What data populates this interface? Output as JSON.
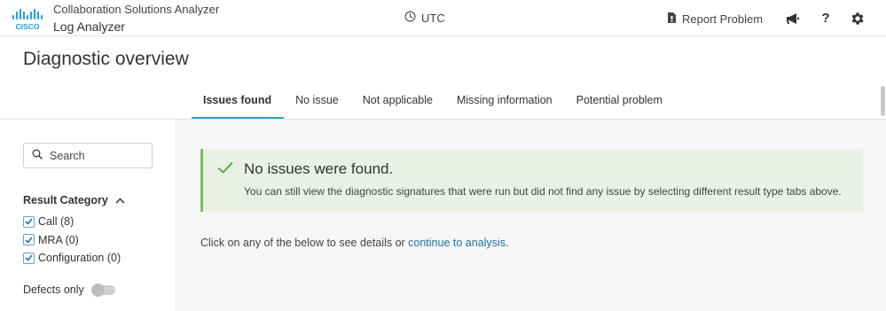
{
  "header": {
    "brand": "CISCO",
    "app_name": "Collaboration Solutions Analyzer",
    "app_sub": "Log Analyzer",
    "timezone": "UTC",
    "report_label": "Report Problem",
    "icons": [
      "megaphone-icon",
      "help-icon",
      "gear-icon"
    ]
  },
  "page": {
    "title": "Diagnostic overview"
  },
  "tabs": [
    {
      "label": "Issues found",
      "active": true
    },
    {
      "label": "No issue",
      "active": false
    },
    {
      "label": "Not applicable",
      "active": false
    },
    {
      "label": "Missing information",
      "active": false
    },
    {
      "label": "Potential problem",
      "active": false
    }
  ],
  "sidebar": {
    "search_placeholder": "Search",
    "category_title": "Result Category",
    "categories": [
      {
        "label": "Call (8)",
        "checked": true
      },
      {
        "label": "MRA (0)",
        "checked": true
      },
      {
        "label": "Configuration (0)",
        "checked": true
      }
    ],
    "defects_label": "Defects only",
    "defects_on": false
  },
  "main": {
    "alert_title": "No issues were found.",
    "alert_message": "You can still view the diagnostic signatures that were run but did not find any issue by selecting different result type tabs above.",
    "hint_text": "Click on any of the below to see details or ",
    "hint_link": "continue to analysis",
    "hint_end": "."
  },
  "colors": {
    "accent": "#2ba0c4",
    "success_border": "#78c05f",
    "success_bg": "#e9f1e6",
    "link": "#1e72a8"
  }
}
